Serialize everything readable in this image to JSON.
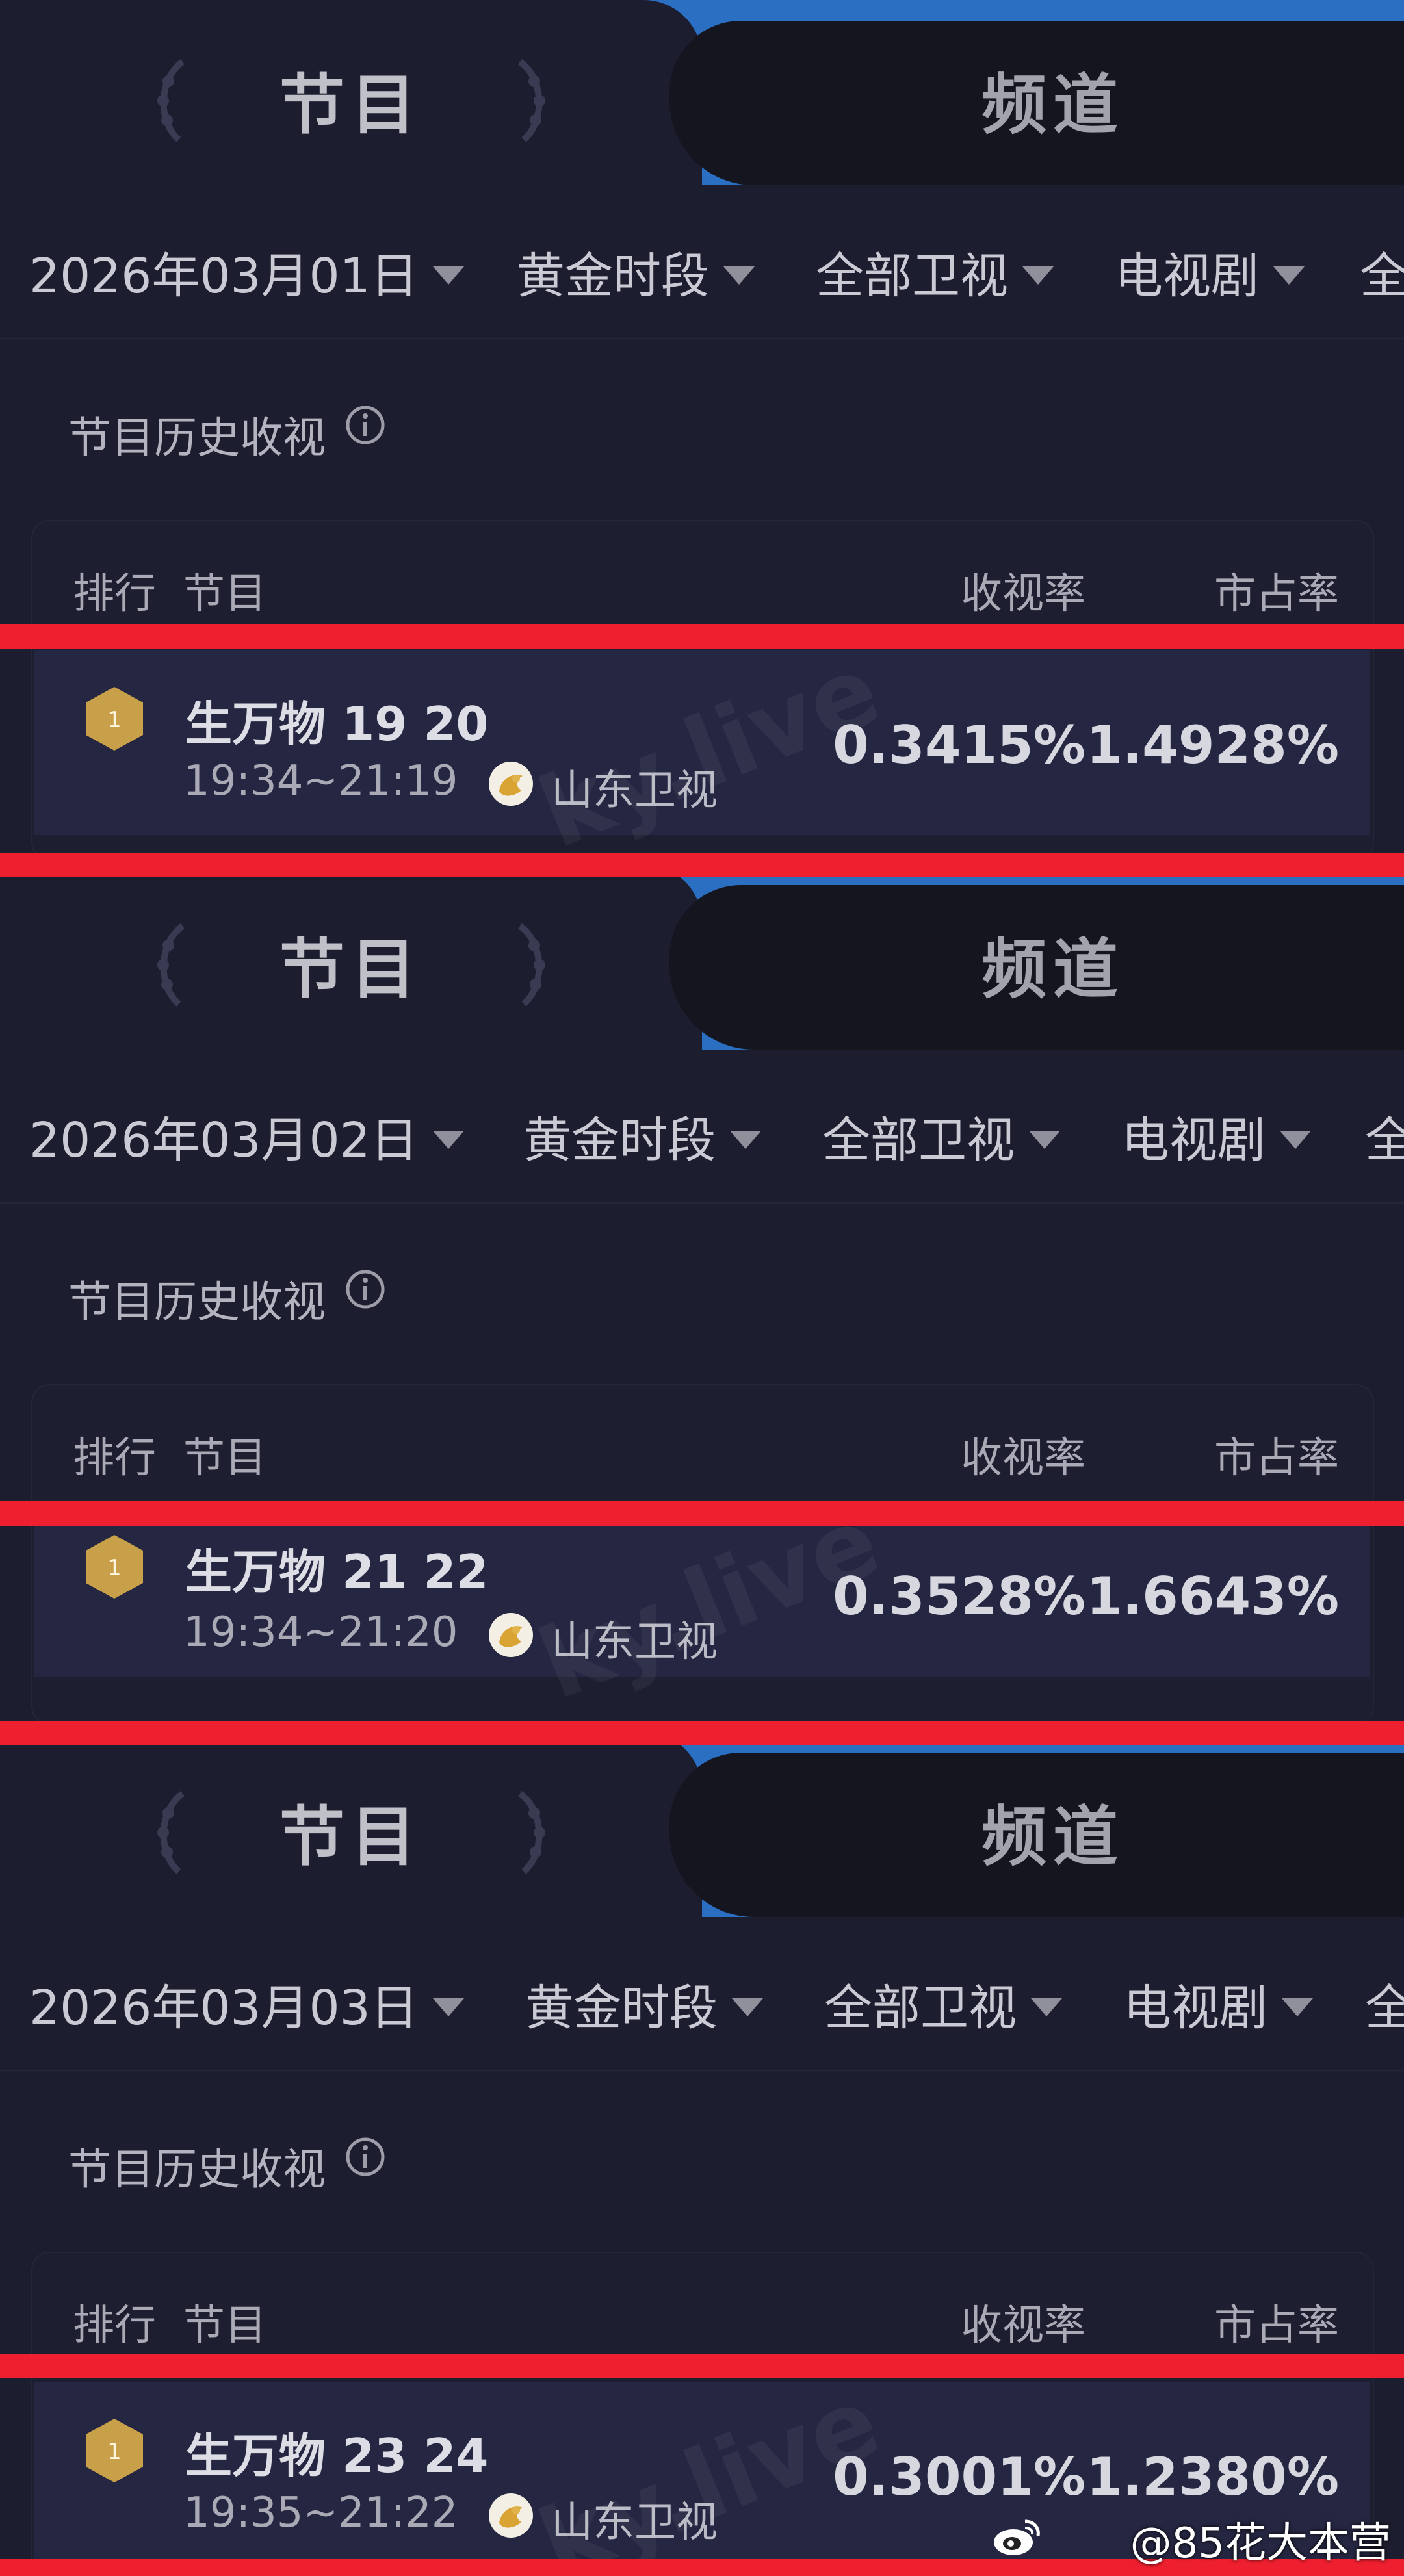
{
  "screenshots": [
    {
      "tabs": {
        "active": "节目",
        "inactive": "频道"
      },
      "filters": {
        "date": "2026年03月01日",
        "timeslot": "黄金时段",
        "channel_scope": "全部卫视",
        "genre": "电视剧",
        "extra": "全"
      },
      "section_title": "节目历史收视",
      "table_headers": {
        "rank": "排行",
        "program": "节目",
        "rating": "收视率",
        "share": "市占率"
      },
      "row": {
        "rank": "1",
        "program": "生万物 19 20",
        "time": "19:34~21:19",
        "channel": "山东卫视",
        "rating": "0.3415%",
        "share": "1.4928%"
      },
      "watermark": "ky.live"
    },
    {
      "tabs": {
        "active": "节目",
        "inactive": "频道"
      },
      "filters": {
        "date": "2026年03月02日",
        "timeslot": "黄金时段",
        "channel_scope": "全部卫视",
        "genre": "电视剧",
        "extra": "全"
      },
      "section_title": "节目历史收视",
      "table_headers": {
        "rank": "排行",
        "program": "节目",
        "rating": "收视率",
        "share": "市占率"
      },
      "row": {
        "rank": "1",
        "program": "生万物 21 22",
        "time": "19:34~21:20",
        "channel": "山东卫视",
        "rating": "0.3528%",
        "share": "1.6643%"
      },
      "watermark": "ky.live"
    },
    {
      "tabs": {
        "active": "节目",
        "inactive": "频道"
      },
      "filters": {
        "date": "2026年03月03日",
        "timeslot": "黄金时段",
        "channel_scope": "全部卫视",
        "genre": "电视剧",
        "extra": "全"
      },
      "section_title": "节目历史收视",
      "table_headers": {
        "rank": "排行",
        "program": "节目",
        "rating": "收视率",
        "share": "市占率"
      },
      "row": {
        "rank": "1",
        "program": "生万物 23 24",
        "time": "19:35~21:22",
        "channel": "山东卫视",
        "rating": "0.3001%",
        "share": "1.2380%"
      },
      "watermark": "ky.live"
    }
  ],
  "credit": "@85花大本营",
  "colors": {
    "highlight_line": "#ee1f2e",
    "tab_accent": "#2a6fc2",
    "background": "#1c1d2e",
    "medal_gold": "#c9a04a"
  }
}
